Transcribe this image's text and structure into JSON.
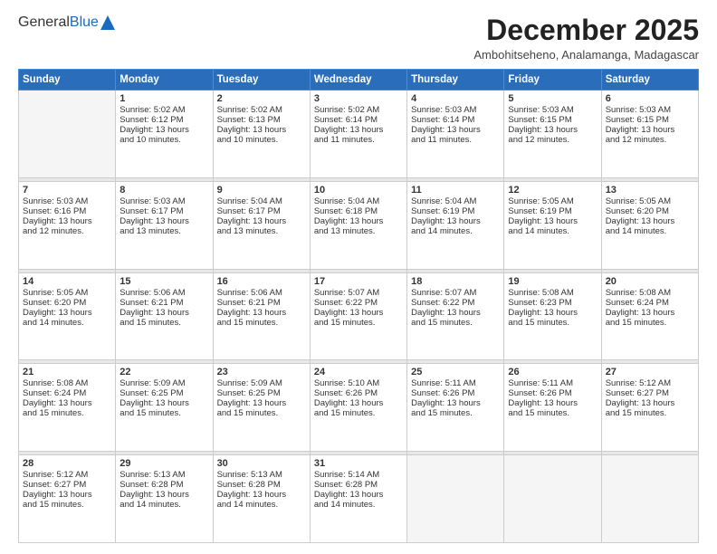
{
  "header": {
    "logo_general": "General",
    "logo_blue": "Blue",
    "title": "December 2025",
    "subtitle": "Ambohitseheno, Analamanga, Madagascar"
  },
  "calendar": {
    "headers": [
      "Sunday",
      "Monday",
      "Tuesday",
      "Wednesday",
      "Thursday",
      "Friday",
      "Saturday"
    ],
    "weeks": [
      [
        {
          "num": "",
          "lines": []
        },
        {
          "num": "1",
          "lines": [
            "Sunrise: 5:02 AM",
            "Sunset: 6:12 PM",
            "Daylight: 13 hours",
            "and 10 minutes."
          ]
        },
        {
          "num": "2",
          "lines": [
            "Sunrise: 5:02 AM",
            "Sunset: 6:13 PM",
            "Daylight: 13 hours",
            "and 10 minutes."
          ]
        },
        {
          "num": "3",
          "lines": [
            "Sunrise: 5:02 AM",
            "Sunset: 6:14 PM",
            "Daylight: 13 hours",
            "and 11 minutes."
          ]
        },
        {
          "num": "4",
          "lines": [
            "Sunrise: 5:03 AM",
            "Sunset: 6:14 PM",
            "Daylight: 13 hours",
            "and 11 minutes."
          ]
        },
        {
          "num": "5",
          "lines": [
            "Sunrise: 5:03 AM",
            "Sunset: 6:15 PM",
            "Daylight: 13 hours",
            "and 12 minutes."
          ]
        },
        {
          "num": "6",
          "lines": [
            "Sunrise: 5:03 AM",
            "Sunset: 6:15 PM",
            "Daylight: 13 hours",
            "and 12 minutes."
          ]
        }
      ],
      [
        {
          "num": "7",
          "lines": [
            "Sunrise: 5:03 AM",
            "Sunset: 6:16 PM",
            "Daylight: 13 hours",
            "and 12 minutes."
          ]
        },
        {
          "num": "8",
          "lines": [
            "Sunrise: 5:03 AM",
            "Sunset: 6:17 PM",
            "Daylight: 13 hours",
            "and 13 minutes."
          ]
        },
        {
          "num": "9",
          "lines": [
            "Sunrise: 5:04 AM",
            "Sunset: 6:17 PM",
            "Daylight: 13 hours",
            "and 13 minutes."
          ]
        },
        {
          "num": "10",
          "lines": [
            "Sunrise: 5:04 AM",
            "Sunset: 6:18 PM",
            "Daylight: 13 hours",
            "and 13 minutes."
          ]
        },
        {
          "num": "11",
          "lines": [
            "Sunrise: 5:04 AM",
            "Sunset: 6:19 PM",
            "Daylight: 13 hours",
            "and 14 minutes."
          ]
        },
        {
          "num": "12",
          "lines": [
            "Sunrise: 5:05 AM",
            "Sunset: 6:19 PM",
            "Daylight: 13 hours",
            "and 14 minutes."
          ]
        },
        {
          "num": "13",
          "lines": [
            "Sunrise: 5:05 AM",
            "Sunset: 6:20 PM",
            "Daylight: 13 hours",
            "and 14 minutes."
          ]
        }
      ],
      [
        {
          "num": "14",
          "lines": [
            "Sunrise: 5:05 AM",
            "Sunset: 6:20 PM",
            "Daylight: 13 hours",
            "and 14 minutes."
          ]
        },
        {
          "num": "15",
          "lines": [
            "Sunrise: 5:06 AM",
            "Sunset: 6:21 PM",
            "Daylight: 13 hours",
            "and 15 minutes."
          ]
        },
        {
          "num": "16",
          "lines": [
            "Sunrise: 5:06 AM",
            "Sunset: 6:21 PM",
            "Daylight: 13 hours",
            "and 15 minutes."
          ]
        },
        {
          "num": "17",
          "lines": [
            "Sunrise: 5:07 AM",
            "Sunset: 6:22 PM",
            "Daylight: 13 hours",
            "and 15 minutes."
          ]
        },
        {
          "num": "18",
          "lines": [
            "Sunrise: 5:07 AM",
            "Sunset: 6:22 PM",
            "Daylight: 13 hours",
            "and 15 minutes."
          ]
        },
        {
          "num": "19",
          "lines": [
            "Sunrise: 5:08 AM",
            "Sunset: 6:23 PM",
            "Daylight: 13 hours",
            "and 15 minutes."
          ]
        },
        {
          "num": "20",
          "lines": [
            "Sunrise: 5:08 AM",
            "Sunset: 6:24 PM",
            "Daylight: 13 hours",
            "and 15 minutes."
          ]
        }
      ],
      [
        {
          "num": "21",
          "lines": [
            "Sunrise: 5:08 AM",
            "Sunset: 6:24 PM",
            "Daylight: 13 hours",
            "and 15 minutes."
          ]
        },
        {
          "num": "22",
          "lines": [
            "Sunrise: 5:09 AM",
            "Sunset: 6:25 PM",
            "Daylight: 13 hours",
            "and 15 minutes."
          ]
        },
        {
          "num": "23",
          "lines": [
            "Sunrise: 5:09 AM",
            "Sunset: 6:25 PM",
            "Daylight: 13 hours",
            "and 15 minutes."
          ]
        },
        {
          "num": "24",
          "lines": [
            "Sunrise: 5:10 AM",
            "Sunset: 6:26 PM",
            "Daylight: 13 hours",
            "and 15 minutes."
          ]
        },
        {
          "num": "25",
          "lines": [
            "Sunrise: 5:11 AM",
            "Sunset: 6:26 PM",
            "Daylight: 13 hours",
            "and 15 minutes."
          ]
        },
        {
          "num": "26",
          "lines": [
            "Sunrise: 5:11 AM",
            "Sunset: 6:26 PM",
            "Daylight: 13 hours",
            "and 15 minutes."
          ]
        },
        {
          "num": "27",
          "lines": [
            "Sunrise: 5:12 AM",
            "Sunset: 6:27 PM",
            "Daylight: 13 hours",
            "and 15 minutes."
          ]
        }
      ],
      [
        {
          "num": "28",
          "lines": [
            "Sunrise: 5:12 AM",
            "Sunset: 6:27 PM",
            "Daylight: 13 hours",
            "and 15 minutes."
          ]
        },
        {
          "num": "29",
          "lines": [
            "Sunrise: 5:13 AM",
            "Sunset: 6:28 PM",
            "Daylight: 13 hours",
            "and 14 minutes."
          ]
        },
        {
          "num": "30",
          "lines": [
            "Sunrise: 5:13 AM",
            "Sunset: 6:28 PM",
            "Daylight: 13 hours",
            "and 14 minutes."
          ]
        },
        {
          "num": "31",
          "lines": [
            "Sunrise: 5:14 AM",
            "Sunset: 6:28 PM",
            "Daylight: 13 hours",
            "and 14 minutes."
          ]
        },
        {
          "num": "",
          "lines": []
        },
        {
          "num": "",
          "lines": []
        },
        {
          "num": "",
          "lines": []
        }
      ]
    ]
  }
}
